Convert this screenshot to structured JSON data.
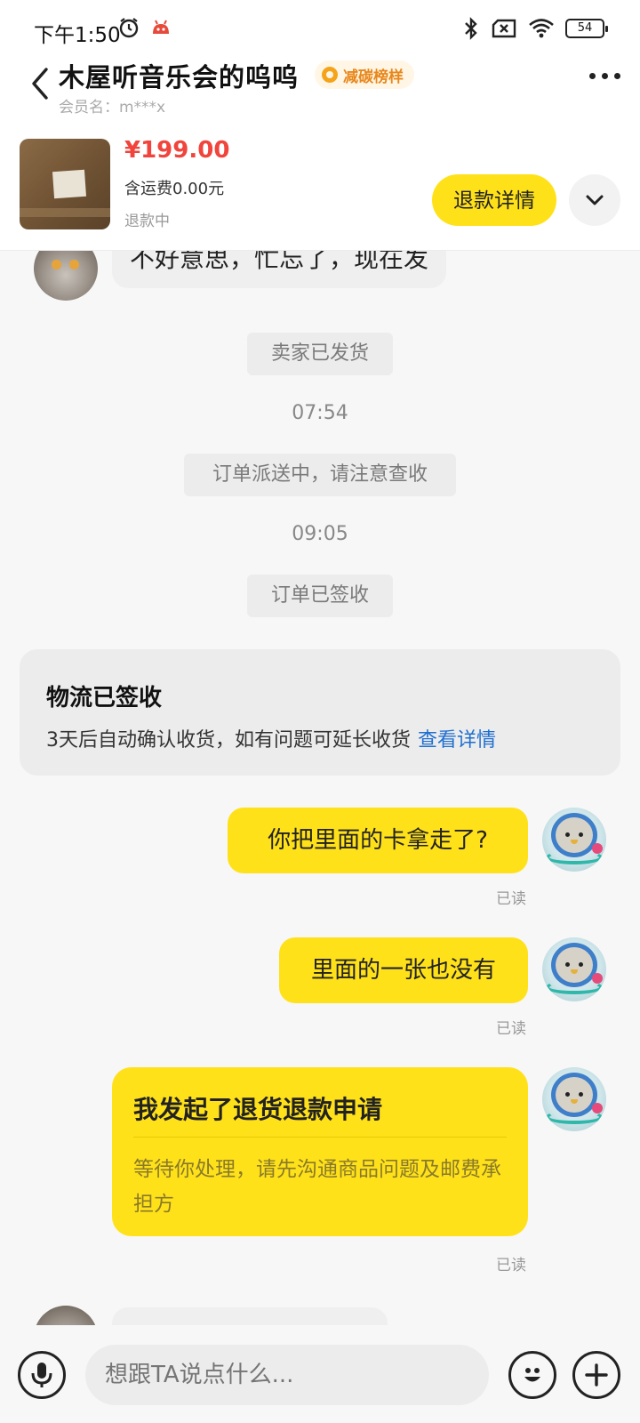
{
  "status_bar": {
    "time": "下午1:50",
    "battery": "54"
  },
  "header": {
    "shop_name": "木屋听音乐会的呜呜",
    "badge": "减碳榜样",
    "member": "会员名：m***x"
  },
  "product": {
    "price": "¥199.00",
    "shipping": "含运费0.00元",
    "status": "退款中",
    "refund_button": "退款详情"
  },
  "chat": {
    "incoming_1": "不好意思，忙忘了，现在发",
    "system_shipped": "卖家已发货",
    "time_1": "07:54",
    "system_delivering": "订单派送中，请注意查收",
    "time_2": "09:05",
    "system_signed": "订单已签收",
    "logistics": {
      "title": "物流已签收",
      "desc": "3天后自动确认收货，如有问题可延长收货",
      "link": "查看详情"
    },
    "outgoing_1": "你把里面的卡拿走了?",
    "outgoing_2": "里面的一张也没有",
    "refund_card": {
      "title": "我发起了退货退款申请",
      "desc": "等待你处理，请先沟通商品问题及邮费承担方"
    },
    "read_label": "已读"
  },
  "input": {
    "placeholder": "想跟TA说点什么..."
  },
  "colors": {
    "accent_yellow": "#ffe11a",
    "price_red": "#f0443c",
    "link_blue": "#1f6fd1"
  }
}
